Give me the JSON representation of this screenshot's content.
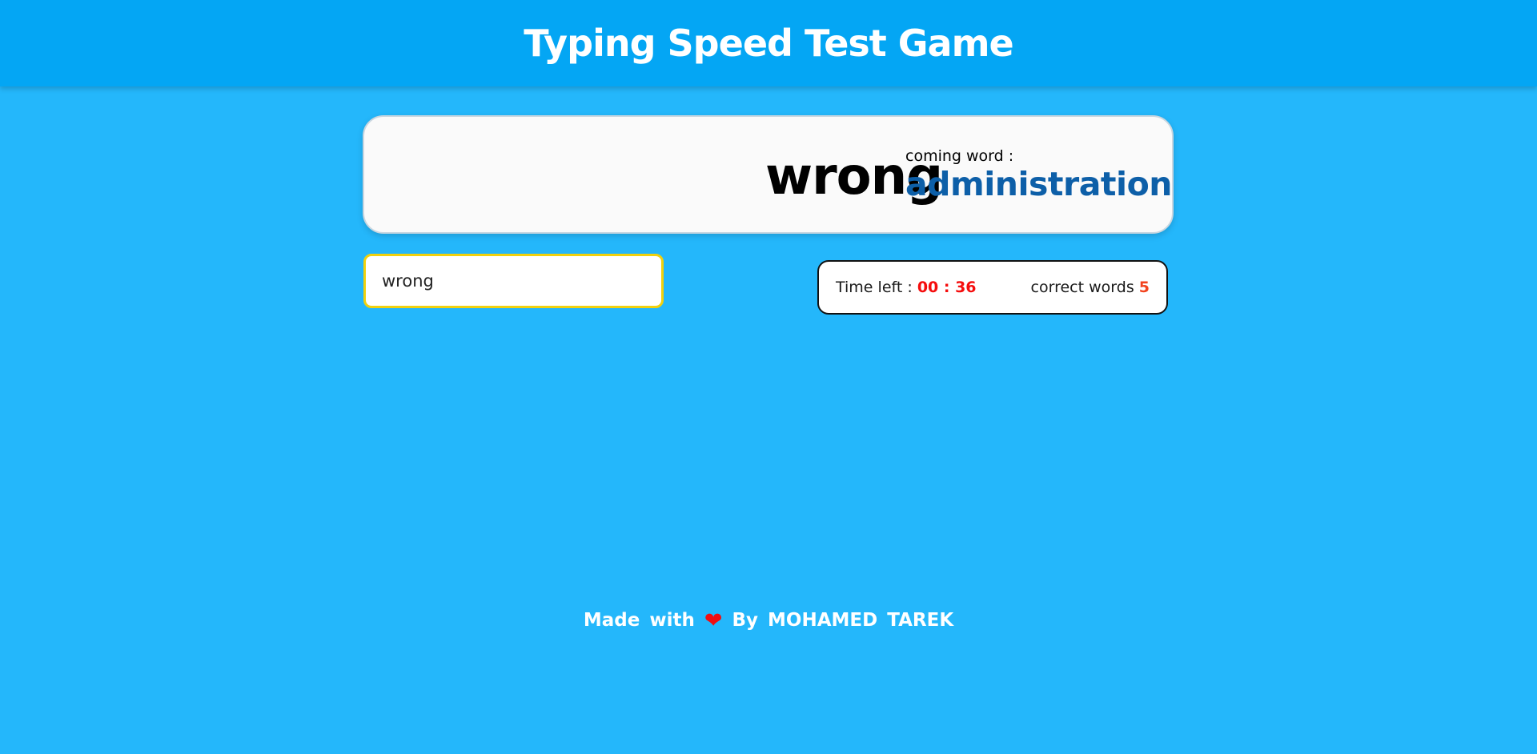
{
  "header": {
    "title": "Typing Speed Test Game"
  },
  "game": {
    "current_word": "wrong",
    "coming_label": "coming word :",
    "coming_word": "administration",
    "input_value": "wrong"
  },
  "stats": {
    "time_label": "Time left :",
    "time_value": "00 : 36",
    "correct_label": "correct words",
    "correct_value": "5"
  },
  "footer": {
    "made_with": "Made with",
    "heart_icon": "heart-icon",
    "by_text": "By MOHAMED TAREK"
  },
  "colors": {
    "background": "#24b7fb",
    "header": "#04a6f4",
    "coming_word": "#0d5fa8",
    "time": "#f50d0d",
    "input_border": "#f1d10d"
  }
}
